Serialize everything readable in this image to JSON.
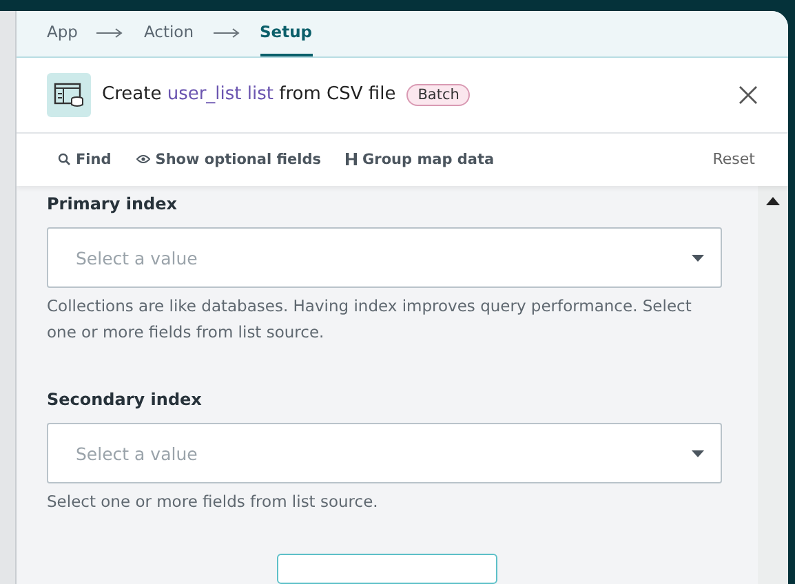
{
  "breadcrumb": [
    {
      "label": "App",
      "selected": false
    },
    {
      "label": "Action",
      "selected": false
    },
    {
      "label": "Setup",
      "selected": true
    }
  ],
  "header": {
    "title_start": "Create ",
    "title_highlight": "user_list list",
    "title_end": " from CSV file",
    "badge": "Batch"
  },
  "toolbar": {
    "items": [
      {
        "kind": "search",
        "label": "Find"
      },
      {
        "kind": "eye",
        "label": "Show optional fields"
      },
      {
        "kind": "group",
        "label": "Group map data"
      }
    ],
    "reset": "Reset"
  },
  "fields": [
    {
      "label": "Primary index",
      "placeholder": "Select a value",
      "hint": "Collections are like databases. Having index improves query performance. Select one or more fields from list source."
    },
    {
      "label": "Secondary index",
      "placeholder": "Select a value",
      "hint": "Select one or more fields from list source."
    }
  ]
}
